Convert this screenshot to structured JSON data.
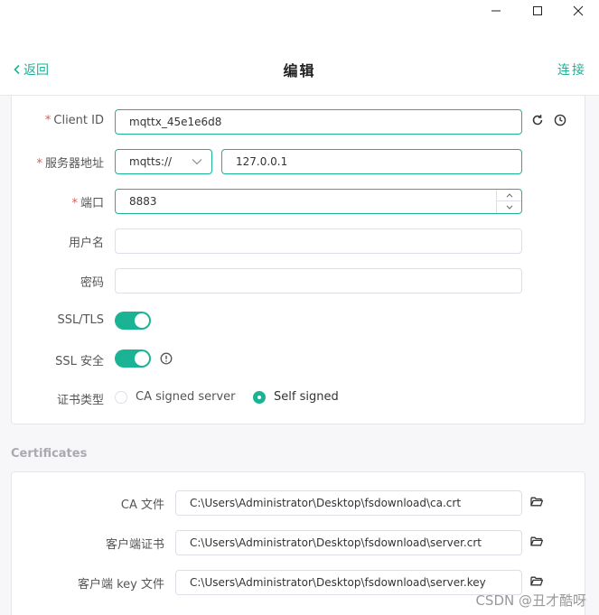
{
  "window": {
    "controls": [
      "minimize",
      "maximize",
      "close"
    ]
  },
  "header": {
    "back_label": "返回",
    "title": "编辑",
    "connect_label": "连接"
  },
  "form": {
    "client_id": {
      "label": "Client ID",
      "required": "*",
      "value": "mqttx_45e1e6d8"
    },
    "host": {
      "label": "服务器地址",
      "required": "*",
      "protocol": "mqtts://",
      "value": "127.0.0.1"
    },
    "port": {
      "label": "端口",
      "required": "*",
      "value": "8883"
    },
    "username": {
      "label": "用户名",
      "value": ""
    },
    "password": {
      "label": "密码",
      "value": ""
    },
    "ssl_tls": {
      "label": "SSL/TLS",
      "enabled": true
    },
    "ssl_secure": {
      "label": "SSL 安全",
      "enabled": true
    },
    "cert_type": {
      "label": "证书类型",
      "options": [
        "CA signed server",
        "Self signed"
      ],
      "selected": "Self signed"
    }
  },
  "certificates": {
    "section_title": "Certificates",
    "ca_file": {
      "label": "CA 文件",
      "value": "C:\\Users\\Administrator\\Desktop\\fsdownload\\ca.crt"
    },
    "client_cert": {
      "label": "客户端证书",
      "value": "C:\\Users\\Administrator\\Desktop\\fsdownload\\server.crt"
    },
    "client_key": {
      "label": "客户端 key 文件",
      "value": "C:\\Users\\Administrator\\Desktop\\fsdownload\\server.key"
    }
  },
  "watermark": "CSDN @丑才酷呀",
  "colors": {
    "accent": "#1ab394",
    "required": "#e8574f"
  }
}
